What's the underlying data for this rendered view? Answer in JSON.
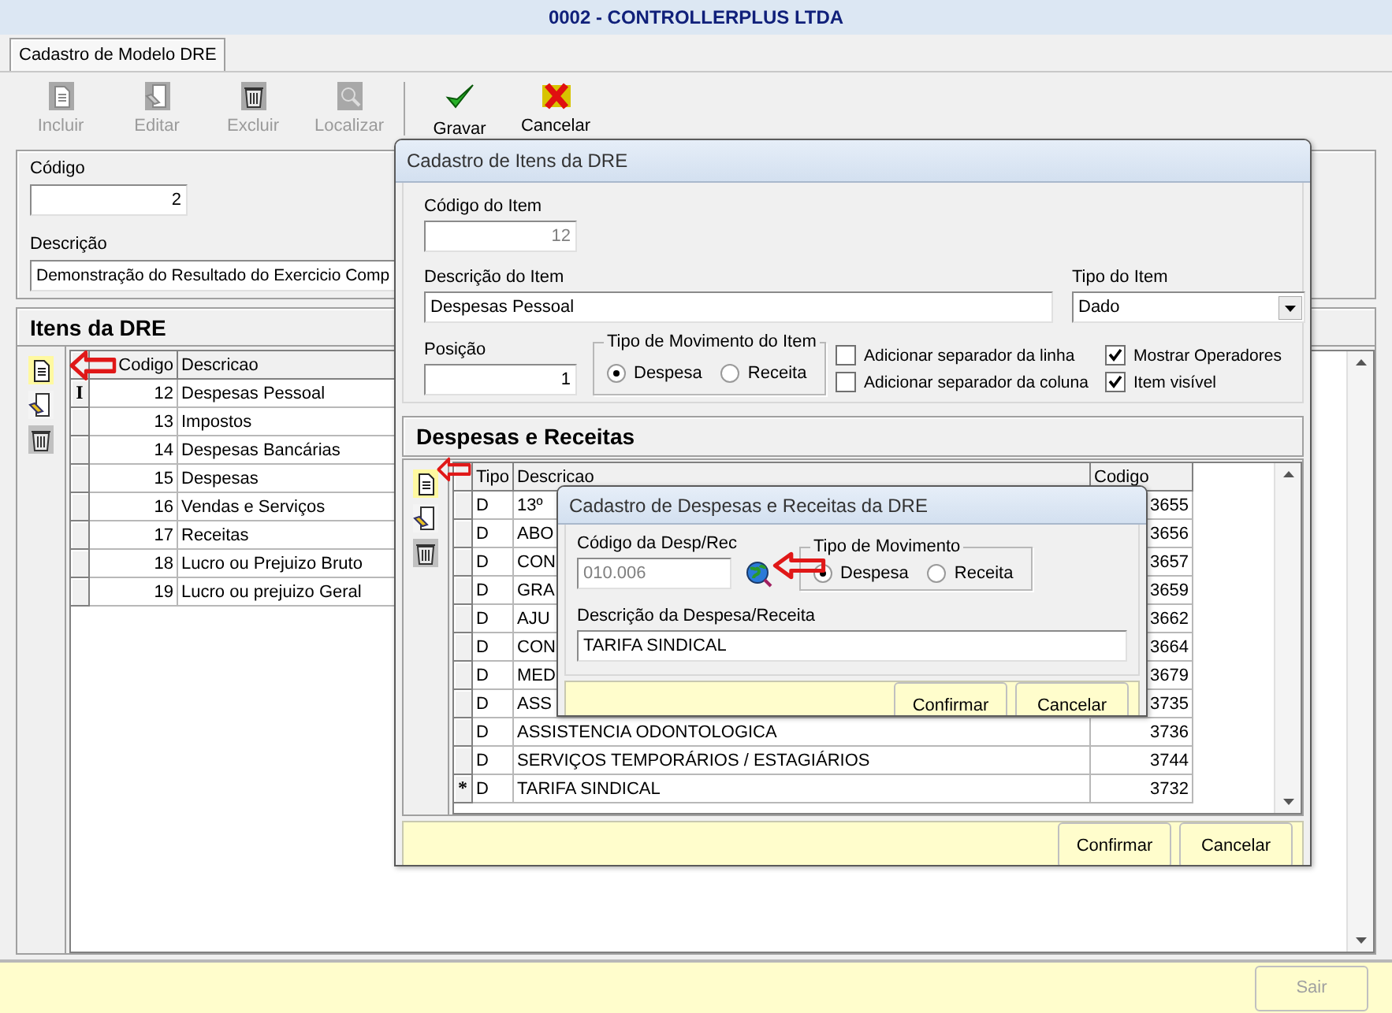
{
  "window": {
    "title": "0002 - CONTROLLERPLUS LTDA"
  },
  "tabs": [
    {
      "label": "Cadastro de Modelo DRE",
      "selected": true
    }
  ],
  "toolbar": {
    "record_actions": [
      {
        "kind": "new",
        "label": "Incluir",
        "disabled": true
      },
      {
        "kind": "edit",
        "label": "Editar",
        "disabled": true
      },
      {
        "kind": "delete",
        "label": "Excluir",
        "disabled": true
      },
      {
        "kind": "find",
        "label": "Localizar",
        "disabled": true
      }
    ],
    "edit_actions": [
      {
        "kind": "save",
        "label": "Gravar",
        "disabled": false
      },
      {
        "kind": "cancel",
        "label": "Cancelar",
        "disabled": false
      }
    ]
  },
  "form": {
    "code": {
      "label": "Código",
      "value": "2"
    },
    "description": {
      "label": "Descrição",
      "value": "Demonstração do Resultado do Exercicio Comp"
    }
  },
  "items_panel": {
    "title": "Itens da DRE",
    "columns": [
      "Codigo",
      "Descricao"
    ],
    "rows": [
      {
        "marker": "I",
        "code": "12",
        "description": "Despesas Pessoal"
      },
      {
        "code": "13",
        "description": "Impostos"
      },
      {
        "code": "14",
        "description": "Despesas Bancárias"
      },
      {
        "code": "15",
        "description": "Despesas"
      },
      {
        "code": "16",
        "description": "Vendas e Serviços"
      },
      {
        "code": "17",
        "description": "Receitas"
      },
      {
        "code": "18",
        "description": "Lucro ou Prejuizo Bruto"
      },
      {
        "code": "19",
        "description": "Lucro ou prejuizo Geral"
      }
    ]
  },
  "items_dialog": {
    "title": "Cadastro de Itens da DRE",
    "code": {
      "label": "Código do Item",
      "value": "12",
      "disabled": true
    },
    "description": {
      "label": "Descrição do Item",
      "value": "Despesas Pessoal"
    },
    "item_type": {
      "label": "Tipo do Item",
      "value": "Dado"
    },
    "position": {
      "label": "Posição",
      "value": "1"
    },
    "movement": {
      "title": "Tipo de Movimento do Item",
      "options": [
        {
          "label": "Despesa",
          "selected": true
        },
        {
          "label": "Receita",
          "selected": false
        }
      ]
    },
    "checkboxes": [
      {
        "label": "Adicionar separador da linha",
        "checked": false
      },
      {
        "label": "Mostrar Operadores",
        "checked": true
      },
      {
        "label": "Adicionar separador da coluna",
        "checked": false
      },
      {
        "label": "Item visível",
        "checked": true
      }
    ],
    "subpanel": {
      "title": "Despesas e Receitas",
      "columns": [
        "Tipo",
        "Descricao",
        "Codigo"
      ],
      "rows": [
        {
          "type": "D",
          "description": "13º",
          "code": "3655"
        },
        {
          "type": "D",
          "description": "ABO",
          "code": "3656"
        },
        {
          "type": "D",
          "description": "CON",
          "code": "3657"
        },
        {
          "type": "D",
          "description": "GRA",
          "code": "3659"
        },
        {
          "type": "D",
          "description": "AJU",
          "code": "3662"
        },
        {
          "type": "D",
          "description": "CON",
          "code": "3664"
        },
        {
          "type": "D",
          "description": "MED",
          "code": "3679"
        },
        {
          "type": "D",
          "description": "ASS",
          "code": "3735"
        },
        {
          "type": "D",
          "description": "ASSISTENCIA ODONTOLOGICA",
          "code": "3736"
        },
        {
          "type": "D",
          "description": "SERVIÇOS TEMPORÁRIOS / ESTAGIÁRIOS",
          "code": "3744"
        },
        {
          "marker": "*",
          "type": "D",
          "description": "TARIFA SINDICAL",
          "code": "3732"
        }
      ]
    },
    "buttons": [
      "Confirmar",
      "Cancelar"
    ]
  },
  "expense_dialog": {
    "title": "Cadastro de Despesas e Receitas da DRE",
    "code": {
      "label": "Código da Desp/Rec",
      "value": "010.006",
      "disabled": true
    },
    "movement": {
      "title": "Tipo de Movimento",
      "options": [
        {
          "label": "Despesa",
          "selected": true
        },
        {
          "label": "Receita",
          "selected": false
        }
      ]
    },
    "description": {
      "label": "Descrição da Despesa/Receita",
      "value": "TARIFA SINDICAL"
    },
    "buttons": [
      "Confirmar",
      "Cancelar"
    ]
  },
  "footer": {
    "buttons": [
      {
        "label": "Sair",
        "disabled": true
      }
    ]
  }
}
